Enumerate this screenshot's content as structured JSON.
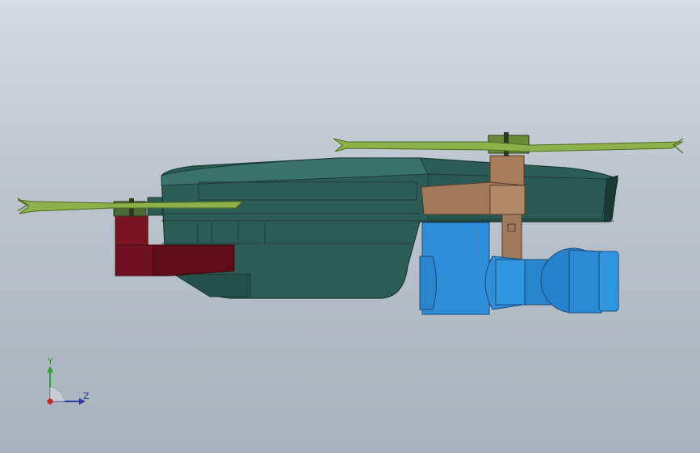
{
  "viewport": {
    "background_top": "#d5dce2",
    "background_bottom": "#a8b2bc"
  },
  "model": {
    "parts": {
      "body": "#2a5a52",
      "body_dark": "#1f4640",
      "propeller": "#8eb04a",
      "arm_front": "#7a1420",
      "arm_rear": "#a0785a",
      "gimbal": "#2e8ed8"
    }
  },
  "triad": {
    "y_label": "Y",
    "z_label": "Z",
    "y_color": "#2f9f2f",
    "z_color": "#2a3aa0",
    "origin_color": "#d02020"
  }
}
